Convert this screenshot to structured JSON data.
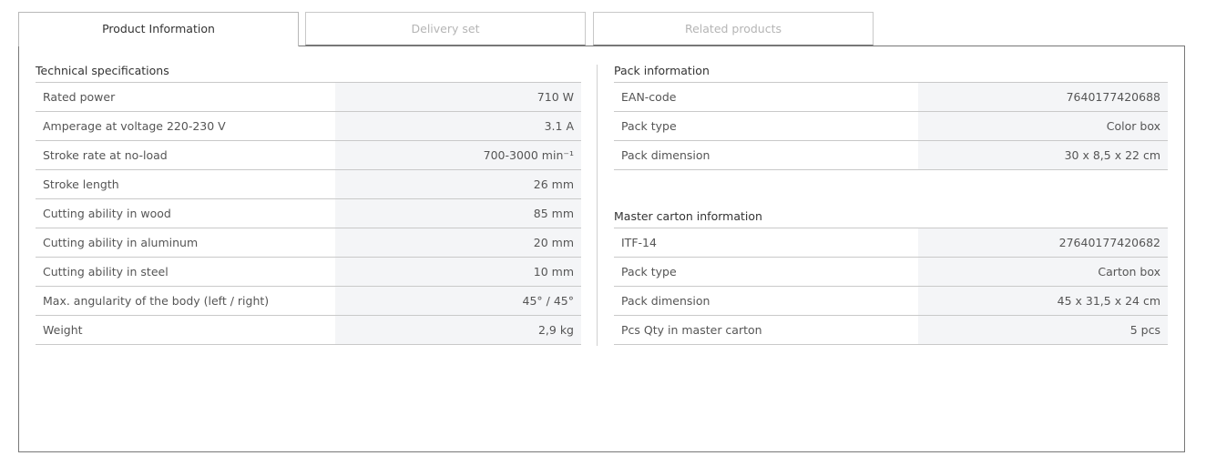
{
  "tabs": [
    {
      "label": "Product Information",
      "active": true
    },
    {
      "label": "Delivery set",
      "active": false
    },
    {
      "label": "Related products",
      "active": false
    }
  ],
  "technical": {
    "title": "Technical specifications",
    "rows": [
      {
        "key": "Rated power",
        "value": "710 W"
      },
      {
        "key": "Amperage at voltage 220-230 V",
        "value": "3.1 A"
      },
      {
        "key": "Stroke rate at no-load",
        "value": "700-3000 min⁻¹"
      },
      {
        "key": "Stroke length",
        "value": "26 mm"
      },
      {
        "key": "Cutting ability in wood",
        "value": "85 mm"
      },
      {
        "key": "Cutting ability in aluminum",
        "value": "20 mm"
      },
      {
        "key": "Cutting ability in steel",
        "value": "10 mm"
      },
      {
        "key": "Max. angularity of the body (left / right)",
        "value": "45° / 45°"
      },
      {
        "key": "Weight",
        "value": "2,9 kg"
      }
    ]
  },
  "pack": {
    "title": "Pack information",
    "rows": [
      {
        "key": "EAN-code",
        "value": "7640177420688"
      },
      {
        "key": "Pack type",
        "value": "Color box"
      },
      {
        "key": "Pack dimension",
        "value": "30 x 8,5 x 22 cm"
      }
    ]
  },
  "master": {
    "title": "Master carton information",
    "rows": [
      {
        "key": "ITF-14",
        "value": "27640177420682"
      },
      {
        "key": "Pack type",
        "value": "Carton box"
      },
      {
        "key": "Pack dimension",
        "value": "45 x 31,5 x 24 cm"
      },
      {
        "key": "Pcs Qty in master carton",
        "value": "5 pcs"
      }
    ]
  }
}
